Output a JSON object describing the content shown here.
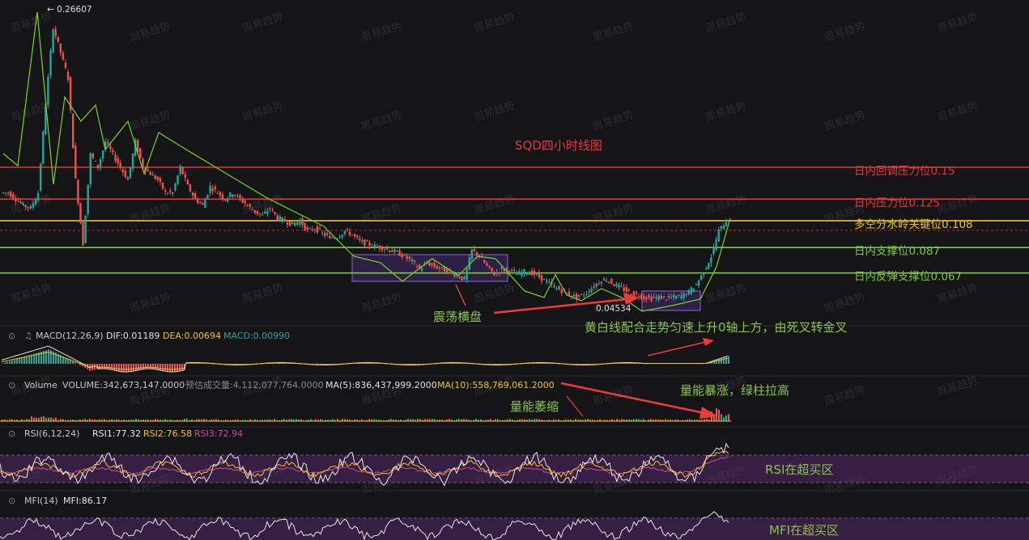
{
  "chart_data": [
    {
      "type": "candlestick",
      "title": "SQD四小时线图",
      "price_range": [
        0.03,
        0.28
      ],
      "max_marker": "← 0.26607",
      "min_marker": "0.04534",
      "levels": [
        {
          "label": "日内回调压力位0.15",
          "value": 0.15,
          "color": "#e8383b"
        },
        {
          "label": "日内压力位0.125",
          "value": 0.125,
          "color": "#e8383b"
        },
        {
          "label": "多空分水岭关键位0.108",
          "value": 0.108,
          "color": "#f0c419"
        },
        {
          "label": "日内支撑位0.087",
          "value": 0.087,
          "color": "#7ec83a"
        },
        {
          "label": "日内反弹支撑位0.067",
          "value": 0.067,
          "color": "#7ec83a"
        }
      ],
      "close_approx": [
        0.13,
        0.13,
        0.125,
        0.12,
        0.118,
        0.13,
        0.2,
        0.26,
        0.24,
        0.22,
        0.14,
        0.09,
        0.16,
        0.15,
        0.17,
        0.16,
        0.15,
        0.14,
        0.17,
        0.15,
        0.145,
        0.14,
        0.13,
        0.13,
        0.15,
        0.135,
        0.125,
        0.12,
        0.135,
        0.13,
        0.125,
        0.13,
        0.125,
        0.12,
        0.115,
        0.112,
        0.118,
        0.11,
        0.108,
        0.105,
        0.108,
        0.1,
        0.102,
        0.098,
        0.095,
        0.095,
        0.1,
        0.097,
        0.092,
        0.09,
        0.088,
        0.087,
        0.085,
        0.083,
        0.08,
        0.076,
        0.07,
        0.075,
        0.072,
        0.07,
        0.068,
        0.065,
        0.062,
        0.085,
        0.08,
        0.072,
        0.066,
        0.07,
        0.069,
        0.066,
        0.068,
        0.067,
        0.064,
        0.06,
        0.056,
        0.053,
        0.05,
        0.048,
        0.05,
        0.055,
        0.06,
        0.062,
        0.058,
        0.055,
        0.052,
        0.05,
        0.048,
        0.047,
        0.048,
        0.047,
        0.048,
        0.049,
        0.052,
        0.058,
        0.068,
        0.08,
        0.1,
        0.108
      ],
      "annotations": [
        "震荡横盘"
      ]
    },
    {
      "type": "line",
      "name": "MACD",
      "header": {
        "title": "MACD(12,26,9)",
        "dif": "DIF:0.01189",
        "dea": "DEA:0.00694",
        "macd": "MACD:0.00990"
      },
      "annotation": "黄白线配合走势匀速上升0轴上方，由死叉转金叉"
    },
    {
      "type": "bar",
      "name": "Volume",
      "header": {
        "title": "Volume",
        "volume": "VOLUME:342,673,147.0000",
        "estimate": "预估成交量:4,112,077,764.0000",
        "ma5": "MA(5):836,437,999.2000",
        "ma10": "MA(10):558,769,061.2000"
      },
      "annotations": [
        "量能萎缩",
        "量能暴涨，绿柱拉高"
      ]
    },
    {
      "type": "line",
      "name": "RSI",
      "header": {
        "title": "RSI(6,12,24)",
        "rsi1": "RSI1:77.32",
        "rsi2": "RSI2:76.58",
        "rsi3": "RSI3:72.94"
      },
      "annotation": "RSI在超买区"
    },
    {
      "type": "line",
      "name": "MFI",
      "header": {
        "title": "MFI(14)",
        "mfi": "MFI:86.17"
      },
      "annotation": "MFI在超买区"
    }
  ],
  "watermark": "周易趋势",
  "colors": {
    "up": "#26a69a",
    "down": "#ef5350",
    "green_label": "#8bc34a",
    "red_label": "#e8383b",
    "yellow_label": "#f0c419",
    "macd_dif": "#e0e0e0",
    "macd_dea": "#f0c419"
  }
}
